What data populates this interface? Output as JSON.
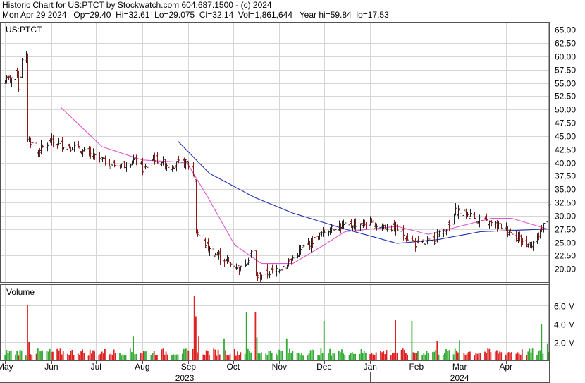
{
  "header": {
    "line1": "Historic Chart for US:PTCT by Stockwatch.com 604.687.1500 - (c) 2024",
    "line2": "Mon Apr 29 2024   Op=29.40  Hi=32.61  Lo=29.075  Cl=32.14  Vol=1,861,644   Year hi=59.84  lo=17.53"
  },
  "chart_data": [
    {
      "type": "ohlc",
      "ticker_label": "US:PTCT",
      "y_ticks": [
        "65.00",
        "62.50",
        "60.00",
        "57.50",
        "55.00",
        "52.50",
        "50.00",
        "47.50",
        "45.00",
        "42.50",
        "40.00",
        "37.50",
        "35.00",
        "32.50",
        "30.00",
        "27.50",
        "25.00",
        "22.50",
        "20.00"
      ],
      "ylim": [
        17.5,
        66.5
      ],
      "grid": true,
      "price_anchors": [
        [
          "2023-04-28",
          55
        ],
        [
          "2023-05-05",
          56
        ],
        [
          "2023-05-09",
          57
        ],
        [
          "2023-05-10",
          54
        ],
        [
          "2023-05-12",
          59
        ],
        [
          "2023-05-15",
          59.5
        ],
        [
          "2023-05-16",
          45
        ],
        [
          "2023-05-22",
          42
        ],
        [
          "2023-05-31",
          44
        ],
        [
          "2023-06-15",
          43
        ],
        [
          "2023-06-30",
          41
        ],
        [
          "2023-07-14",
          39.5
        ],
        [
          "2023-07-28",
          40.5
        ],
        [
          "2023-08-02",
          38.5
        ],
        [
          "2023-08-08",
          41
        ],
        [
          "2023-08-18",
          39.5
        ],
        [
          "2023-08-31",
          40
        ],
        [
          "2023-09-05",
          37
        ],
        [
          "2023-09-06",
          27
        ],
        [
          "2023-09-15",
          23.5
        ],
        [
          "2023-09-29",
          21
        ],
        [
          "2023-10-06",
          20
        ],
        [
          "2023-10-13",
          23
        ],
        [
          "2023-10-16",
          18.5
        ],
        [
          "2023-10-27",
          19.5
        ],
        [
          "2023-11-03",
          20.5
        ],
        [
          "2023-11-10",
          22
        ],
        [
          "2023-11-17",
          24
        ],
        [
          "2023-12-01",
          27
        ],
        [
          "2023-12-08",
          28
        ],
        [
          "2023-12-15",
          28
        ],
        [
          "2023-12-22",
          28.5
        ],
        [
          "2023-12-29",
          28.5
        ],
        [
          "2024-01-10",
          28
        ],
        [
          "2024-01-19",
          27.5
        ],
        [
          "2024-02-01",
          24.5
        ],
        [
          "2024-02-09",
          25
        ],
        [
          "2024-02-23",
          28
        ],
        [
          "2024-02-27",
          31
        ],
        [
          "2024-03-08",
          30
        ],
        [
          "2024-03-15",
          29
        ],
        [
          "2024-03-29",
          28
        ],
        [
          "2024-04-05",
          27
        ],
        [
          "2024-04-15",
          24.5
        ],
        [
          "2024-04-19",
          25
        ],
        [
          "2024-04-25",
          27
        ],
        [
          "2024-04-29",
          32.14
        ]
      ],
      "moving_averages": [
        {
          "color": "#e055d0",
          "start": "2023-06-07",
          "anchors": [
            [
              "2023-06-07",
              50.5
            ],
            [
              "2023-07-05",
              43
            ],
            [
              "2023-08-01",
              40.5
            ],
            [
              "2023-08-31",
              40
            ],
            [
              "2023-09-15",
              33
            ],
            [
              "2023-10-02",
              24.5
            ],
            [
              "2023-10-20",
              21
            ],
            [
              "2023-11-10",
              21
            ],
            [
              "2023-12-01",
              24.5
            ],
            [
              "2023-12-15",
              27
            ],
            [
              "2024-01-19",
              28
            ],
            [
              "2024-02-09",
              26.5
            ],
            [
              "2024-03-01",
              28
            ],
            [
              "2024-03-22",
              29.5
            ],
            [
              "2024-04-05",
              29.5
            ],
            [
              "2024-04-29",
              27.5
            ]
          ]
        },
        {
          "color": "#2030b0",
          "start": "2023-08-25",
          "anchors": [
            [
              "2023-08-25",
              44
            ],
            [
              "2023-09-15",
              38
            ],
            [
              "2023-10-15",
              33.5
            ],
            [
              "2023-11-10",
              30.5
            ],
            [
              "2023-12-15",
              27.5
            ],
            [
              "2024-01-19",
              24.8
            ],
            [
              "2024-02-15",
              25.5
            ],
            [
              "2024-03-15",
              27
            ],
            [
              "2024-04-29",
              27.5
            ]
          ]
        }
      ]
    },
    {
      "type": "bar",
      "title": "Volume",
      "y_ticks": [
        "6.0 M",
        "4.0 M",
        "2.0 M"
      ],
      "ylim": [
        0,
        8.3
      ],
      "colors": {
        "up": "#33aa33",
        "down": "#dd2222"
      },
      "baseline_range": [
        0.5,
        1.3
      ],
      "spikes": [
        [
          "2023-05-16",
          6.0,
          "down"
        ],
        [
          "2023-05-17",
          2.0,
          "down"
        ],
        [
          "2023-07-26",
          2.6,
          "up"
        ],
        [
          "2023-09-05",
          7.0,
          "down"
        ],
        [
          "2023-09-06",
          4.8,
          "down"
        ],
        [
          "2023-09-08",
          2.6,
          "down"
        ],
        [
          "2023-09-25",
          2.4,
          "up"
        ],
        [
          "2023-10-10",
          5.3,
          "up"
        ],
        [
          "2023-10-16",
          5.3,
          "down"
        ],
        [
          "2023-10-17",
          2.5,
          "up"
        ],
        [
          "2023-11-06",
          2.4,
          "up"
        ],
        [
          "2023-12-01",
          4.3,
          "up"
        ],
        [
          "2024-01-18",
          4.4,
          "down"
        ],
        [
          "2024-01-29",
          4.3,
          "up"
        ],
        [
          "2024-02-15",
          2.1,
          "down"
        ],
        [
          "2024-03-01",
          2.2,
          "up"
        ],
        [
          "2024-04-25",
          4.0,
          "up"
        ],
        [
          "2024-04-29",
          1.86,
          "up"
        ]
      ]
    }
  ],
  "x_axis": {
    "months": [
      {
        "label": "May",
        "date": "2023-05-01"
      },
      {
        "label": "Jun",
        "date": "2023-06-01"
      },
      {
        "label": "Jul",
        "date": "2023-07-01"
      },
      {
        "label": "Aug",
        "date": "2023-08-01"
      },
      {
        "label": "Sep",
        "date": "2023-09-01"
      },
      {
        "label": "Oct",
        "date": "2023-10-01"
      },
      {
        "label": "Nov",
        "date": "2023-11-01"
      },
      {
        "label": "Dec",
        "date": "2023-12-01"
      },
      {
        "label": "Jan",
        "date": "2024-01-01"
      },
      {
        "label": "Feb",
        "date": "2024-02-01"
      },
      {
        "label": "Mar",
        "date": "2024-03-01"
      },
      {
        "label": "Apr",
        "date": "2024-04-01"
      }
    ],
    "years": [
      {
        "label": "2023",
        "start": "2023-04-28",
        "end": "2023-12-31"
      },
      {
        "label": "2024",
        "start": "2024-01-01",
        "end": "2024-04-30"
      }
    ],
    "range": [
      "2023-04-28",
      "2024-04-30"
    ]
  }
}
